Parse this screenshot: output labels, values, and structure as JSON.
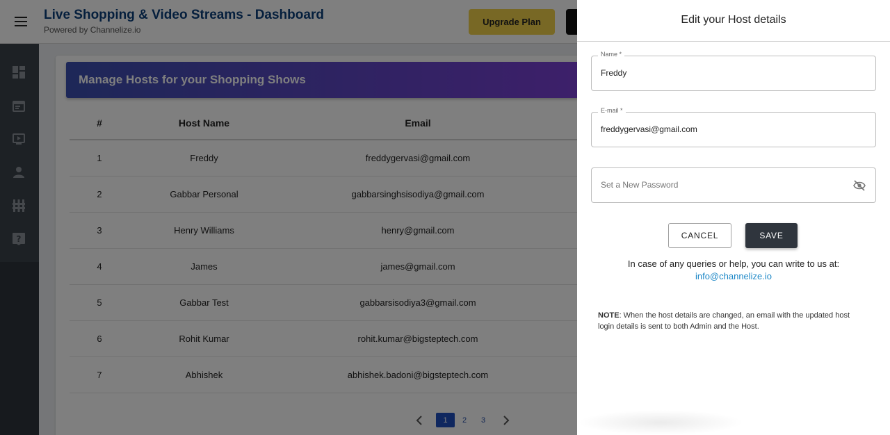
{
  "header": {
    "title": "Live Shopping & Video Streams - Dashboard",
    "subtitle": "Powered by Channelize.io",
    "upgrade_label": "Upgrade Plan"
  },
  "sidebar": {
    "items": [
      {
        "icon": "dashboard-icon"
      },
      {
        "icon": "calendar-icon"
      },
      {
        "icon": "video-icon"
      },
      {
        "icon": "person-icon"
      },
      {
        "icon": "equalizer-icon"
      },
      {
        "icon": "help-icon"
      }
    ]
  },
  "main": {
    "banner_title": "Manage Hosts for your Shopping Shows",
    "table": {
      "headers": [
        "#",
        "Host Name",
        "Email"
      ],
      "rows": [
        {
          "num": "1",
          "name": "Freddy",
          "email": "freddygervasi@gmail.com"
        },
        {
          "num": "2",
          "name": "Gabbar Personal",
          "email": "gabbarsinghsisodiya@gmail.com"
        },
        {
          "num": "3",
          "name": "Henry Williams",
          "email": "henry@gmail.com"
        },
        {
          "num": "4",
          "name": "James",
          "email": "james@gmail.com"
        },
        {
          "num": "5",
          "name": "Gabbar Test",
          "email": "gabbarsisodiya3@gmail.com"
        },
        {
          "num": "6",
          "name": "Rohit Kumar",
          "email": "rohit.kumar@bigsteptech.com"
        },
        {
          "num": "7",
          "name": "Abhishek",
          "email": "abhishek.badoni@bigsteptech.com"
        }
      ]
    },
    "pagination": {
      "pages": [
        "1",
        "2",
        "3"
      ],
      "current": "1"
    }
  },
  "drawer": {
    "title": "Edit your Host details",
    "name_label": "Name *",
    "name_value": "Freddy",
    "email_label": "E-mail *",
    "email_value": "freddygervasi@gmail.com",
    "password_placeholder": "Set a New Password",
    "cancel_label": "CANCEL",
    "save_label": "SAVE",
    "help_text": "In case of any queries or help, you can write to us at:",
    "help_email": "info@channelize.io",
    "note_label": "NOTE",
    "note_text": ": When the host details are changed, an email with the updated host login details is sent to both Admin and the Host."
  },
  "colors": {
    "brand_title": "#0b3e7a",
    "upgrade_button": "#f1d04a",
    "sidebar": "#2f353d",
    "banner_start": "#3b4fb0",
    "banner_end": "#7d3fd6",
    "save_button": "#2f353d",
    "link": "#1e88c7",
    "page_active": "#1f4fbf"
  }
}
